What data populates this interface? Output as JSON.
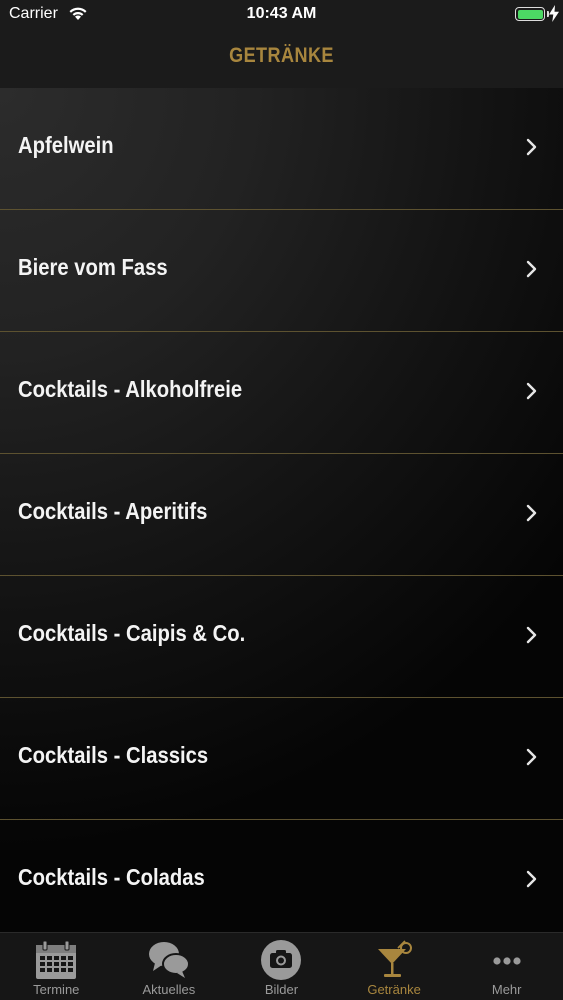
{
  "status_bar": {
    "carrier": "Carrier",
    "time": "10:43 AM",
    "battery_level": 1.0,
    "charging": true
  },
  "nav": {
    "title": "GETRÄNKE"
  },
  "list": {
    "items": [
      {
        "label": "Apfelwein"
      },
      {
        "label": "Biere vom Fass"
      },
      {
        "label": "Cocktails - Alkoholfreie"
      },
      {
        "label": "Cocktails - Aperitifs"
      },
      {
        "label": "Cocktails - Caipis & Co."
      },
      {
        "label": "Cocktails - Classics"
      },
      {
        "label": "Cocktails - Coladas"
      }
    ]
  },
  "tab_bar": {
    "tabs": [
      {
        "label": "Termine",
        "icon": "calendar-icon"
      },
      {
        "label": "Aktuelles",
        "icon": "chat-bubbles-icon"
      },
      {
        "label": "Bilder",
        "icon": "camera-icon"
      },
      {
        "label": "Getränke",
        "icon": "cocktail-glass-icon",
        "active": true
      },
      {
        "label": "Mehr",
        "icon": "more-dots-icon"
      }
    ]
  },
  "colors": {
    "accent": "#a8863e",
    "separator": "#5d5230",
    "battery": "#4cd964",
    "inactive_tab": "#9a9a9a"
  }
}
